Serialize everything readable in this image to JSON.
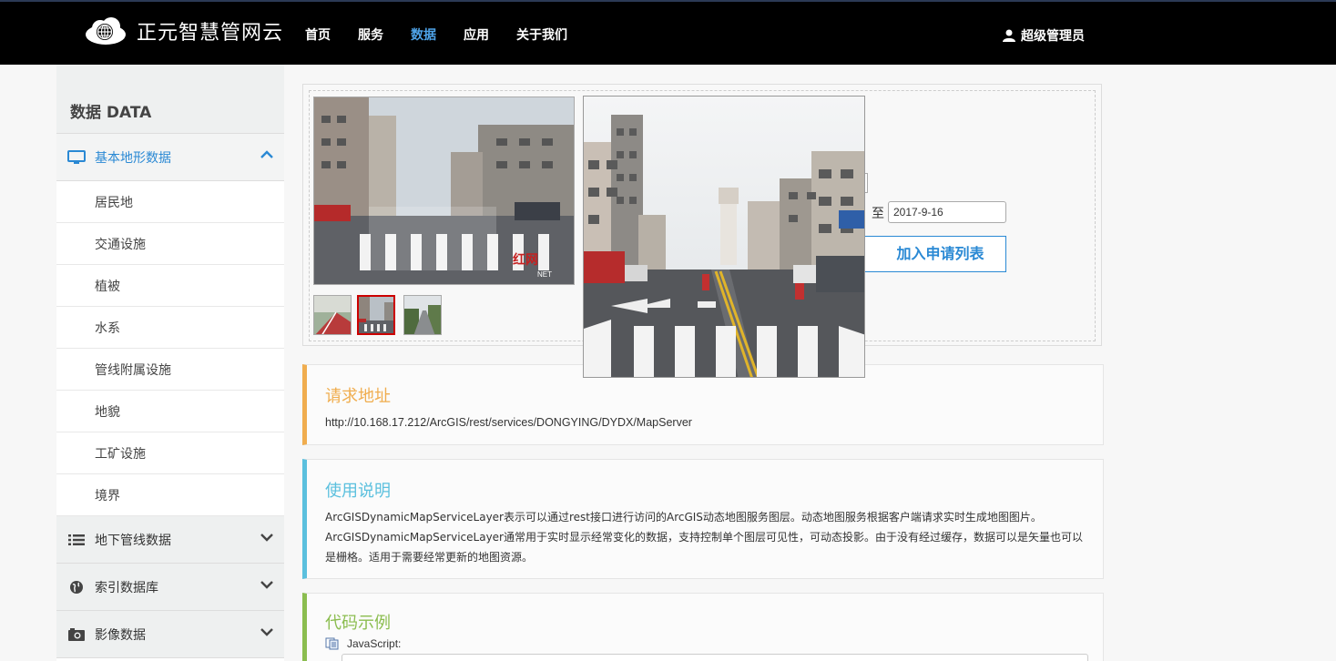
{
  "header": {
    "brand": "正元智慧管网云",
    "nav": [
      "首页",
      "服务",
      "数据",
      "应用",
      "关于我们"
    ],
    "active_nav": "数据",
    "user": "超级管理员"
  },
  "sidebar": {
    "title": "数据 DATA",
    "groups": [
      {
        "label": "基本地形数据",
        "icon": "monitor-icon",
        "open": true,
        "items": [
          "居民地",
          "交通设施",
          "植被",
          "水系",
          "管线附属设施",
          "地貌",
          "工矿设施",
          "境界"
        ]
      },
      {
        "label": "地下管线数据",
        "icon": "list-icon",
        "open": false
      },
      {
        "label": "索引数据库",
        "icon": "globe-icon",
        "open": false
      },
      {
        "label": "影像数据",
        "icon": "camera-icon",
        "open": false
      }
    ]
  },
  "gallery": {
    "watermark": "红网",
    "watermark_sub": "NET",
    "date_separator": "至",
    "date_to": "2017-9-16",
    "apply_button": "加入申请列表"
  },
  "request": {
    "title": "请求地址",
    "url": "http://10.168.17.212/ArcGIS/rest/services/DONGYING/DYDX/MapServer"
  },
  "usage": {
    "title": "使用说明",
    "text": "ArcGISDynamicMapServiceLayer表示可以通过rest接口进行访问的ArcGIS动态地图服务图层。动态地图服务根据客户端请求实时生成地图图片。ArcGISDynamicMapServiceLayer通常用于实时显示经常变化的数据，支持控制单个图层可见性，可动态投影。由于没有经过缓存，数据可以是矢量也可以是栅格。适用于需要经常更新的地图资源。"
  },
  "code": {
    "title": "代码示例",
    "lang": "JavaScript:"
  },
  "colors": {
    "accent": "#2a89d4",
    "request": "#f0ad4e",
    "usage": "#5bc0de",
    "code": "#8bbd4f"
  }
}
